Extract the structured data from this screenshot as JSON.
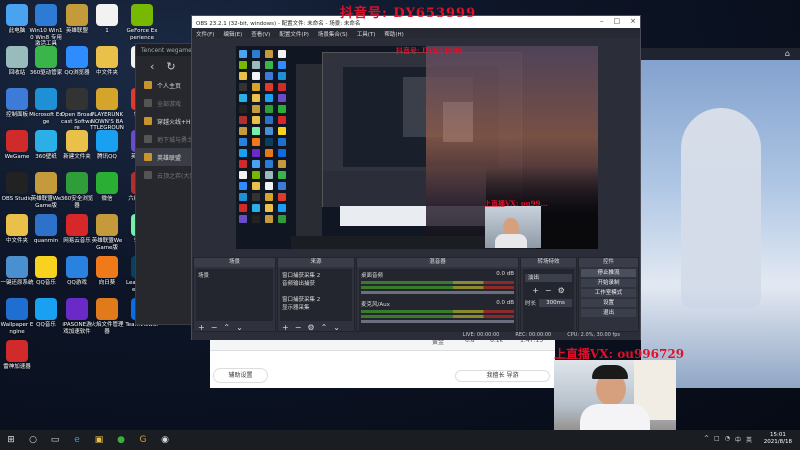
{
  "desktop_icons": [
    {
      "label": "此电脑",
      "color": "#4aa3f0"
    },
    {
      "label": "Win10 Win10 Win8 专用激活工具",
      "color": "#2e7bd6"
    },
    {
      "label": "英雄联盟",
      "color": "#c49a3a"
    },
    {
      "label": "1",
      "color": "#f2f2f2"
    },
    {
      "label": "GeForce Experience",
      "color": "#76b900"
    },
    {
      "label": "回收站",
      "color": "#9bb"
    },
    {
      "label": "360驱动管家",
      "color": "#39b54a"
    },
    {
      "label": "QQ浏览器",
      "color": "#2f8cff"
    },
    {
      "label": "中文件夹",
      "color": "#e8c04a"
    },
    {
      "label": "1",
      "color": "#f2f2f2"
    },
    {
      "label": "控制面板",
      "color": "#3c7bd8"
    },
    {
      "label": "Microsoft Edge",
      "color": "#1e90d6"
    },
    {
      "label": "Open Broadcast Software",
      "color": "#333"
    },
    {
      "label": "PLAYERUNKNOWN'S BATTLEGROUNDS",
      "color": "#d4a52a"
    },
    {
      "label": "鲁大师",
      "color": "#e03a2e"
    },
    {
      "label": "WeGame",
      "color": "#d12a2a"
    },
    {
      "label": "360壁纸",
      "color": "#2ab0e6"
    },
    {
      "label": "新建文件夹",
      "color": "#e8c04a"
    },
    {
      "label": "腾讯QQ",
      "color": "#1aa0f0"
    },
    {
      "label": "英雄时刻",
      "color": "#6a4cc8"
    },
    {
      "label": "OBS Studio",
      "color": "#222"
    },
    {
      "label": "英雄联盟WeGame版",
      "color": "#c49a3a"
    },
    {
      "label": "360安全浏览器",
      "color": "#2f9e3a"
    },
    {
      "label": "微信",
      "color": "#2aae34"
    },
    {
      "label": "六维英雄秀",
      "color": "#b03030"
    },
    {
      "label": "中文件夹",
      "color": "#e8c04a"
    },
    {
      "label": "quanmin",
      "color": "#2d72c8"
    },
    {
      "label": "网易云音乐",
      "color": "#d6282b"
    },
    {
      "label": "英雄联盟WeGame版",
      "color": "#c49a3a"
    },
    {
      "label": "季慷也",
      "color": "#7ea"
    },
    {
      "label": "一键还原系统",
      "color": "#4a8fd0"
    },
    {
      "label": "QQ音乐",
      "color": "#f7d320"
    },
    {
      "label": "QQ游戏",
      "color": "#2a82e0"
    },
    {
      "label": "向日葵",
      "color": "#f07a1a"
    },
    {
      "label": "League of Legends",
      "color": "#0c3e5e"
    },
    {
      "label": "Wallpaper Engine",
      "color": "#1e6fd0"
    },
    {
      "label": "QQ音乐",
      "color": "#1aa0f0"
    },
    {
      "label": "iPASONE游戏加速软件",
      "color": "#6a2ac8"
    },
    {
      "label": "火焰文件管理器",
      "color": "#e07a1a"
    },
    {
      "label": "TeamViewer",
      "color": "#0e6ce0"
    },
    {
      "label": "雷神加速器",
      "color": "#d02a2a"
    }
  ],
  "tencent": {
    "header": "Tencent wegame",
    "items": [
      {
        "label": "个人主页",
        "state": "normal"
      },
      {
        "label": "全部游戏",
        "state": "dim"
      },
      {
        "label": "穿越火线+HD",
        "state": "normal"
      },
      {
        "label": "地下城与勇士",
        "state": "dim"
      },
      {
        "label": "英雄联盟",
        "state": "selected"
      },
      {
        "label": "云顶之弈(大同)",
        "state": "dim"
      }
    ]
  },
  "obs": {
    "title": "OBS 23.2.1 (32-bit, windows) - 配置文件: 未命名 - 场景: 未命名",
    "menu": [
      "文件(F)",
      "编辑(E)",
      "查看(V)",
      "配置文件(P)",
      "场景集合(S)",
      "工具(T)",
      "帮助(H)"
    ],
    "docks": {
      "scenes": {
        "title": "场景",
        "items": [
          "场景"
        ]
      },
      "sources": {
        "title": "来源",
        "items": [
          "窗口捕获采集 2",
          "音频输出捕获",
          "",
          "窗口捕获采集 2",
          "显示器采集"
        ]
      },
      "mixer": {
        "title": "混音器",
        "tracks": [
          {
            "name": "桌面音频",
            "db": "0.0 dB"
          },
          {
            "name": "麦克风/Aux",
            "db": "0.0 dB"
          }
        ]
      },
      "transitions": {
        "title": "转场特效",
        "type": "淡出",
        "duration_label": "时长",
        "duration": "300ms"
      },
      "controls": {
        "title": "控件",
        "buttons": [
          "停止推流",
          "开始录制",
          "工作室模式",
          "设置",
          "退出"
        ]
      }
    },
    "status": {
      "live": "LIVE: 00:00:00",
      "rec": "REC: 00:00:00",
      "cpu": "CPU: 2.0%, 30.00 fps"
    }
  },
  "watermarks": {
    "top": "抖音号: DY653999",
    "preview_top": "抖音号: DY653999",
    "mid": "上直播VX: ou99...",
    "bottom": "上直播VX: ou996729"
  },
  "browser": {
    "button1": "辅助设置",
    "button2": "我擅长 导游",
    "row": [
      "黄金",
      "6.8",
      "6.1k",
      "1:47:15"
    ]
  },
  "taskbar": {
    "icons": [
      "windows-logo",
      "search",
      "task-view",
      "edge",
      "store",
      "wegame",
      "obs"
    ],
    "tray": [
      "^",
      "□",
      "◔",
      "中",
      "英"
    ],
    "time": "15:01",
    "date": "2021/8/18"
  }
}
